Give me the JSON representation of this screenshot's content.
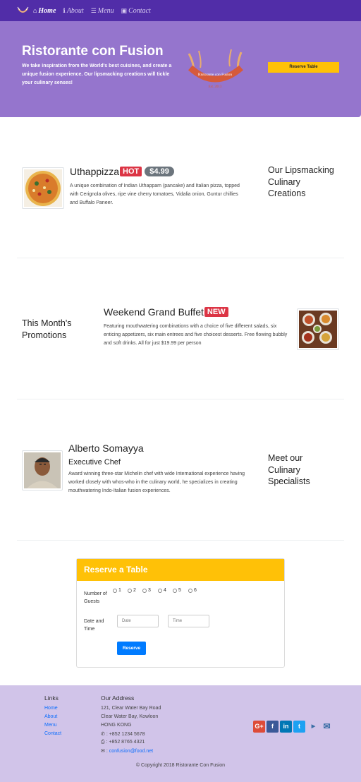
{
  "navbar": {
    "items": [
      {
        "label": "Home",
        "icon": "home-icon"
      },
      {
        "label": "About",
        "icon": "info-icon"
      },
      {
        "label": "Menu",
        "icon": "list-icon"
      },
      {
        "label": "Contact",
        "icon": "address-card-icon"
      }
    ]
  },
  "jumbotron": {
    "title": "Ristorante con Fusion",
    "text": "We take inspiration from the World's best cuisines, and create a unique fusion experience. Our lipsmacking creations will tickle your culinary senses!",
    "logo_text": "Ristorante con Fusion",
    "logo_est": "Est. 2013",
    "reserve_button": "Reserve Table"
  },
  "dish": {
    "name": "Uthappizza",
    "label": "HOT",
    "price": "$4.99",
    "description": "A unique combination of Indian Uthappam (pancake) and Italian pizza, topped with Cerignola olives, ripe vine cherry tomatoes, Vidalia onion, Guntur chillies and Buffalo Paneer.",
    "side_title": "Our Lipsmacking Culinary Creations"
  },
  "promotion": {
    "side_title": "This Month's Promotions",
    "name": "Weekend Grand Buffet",
    "label": "NEW",
    "description": "Featuring mouthwatering combinations with a choice of five different salads, six enticing appetizers, six main entrees and five choicest desserts. Free flowing bubbly and soft drinks. All for just $19.99 per person"
  },
  "leader": {
    "name": "Alberto Somayya",
    "designation": "Executive Chef",
    "description": "Award winning three-star Michelin chef with wide International experience having worked closely with whos-who in the culinary world, he specializes in creating mouthwatering Indo-Italian fusion experiences.",
    "side_title": "Meet our Culinary Specialists"
  },
  "reserve": {
    "header": "Reserve a Table",
    "guests_label": "Number of Guests",
    "guest_options": [
      "1",
      "2",
      "3",
      "4",
      "5",
      "6"
    ],
    "datetime_label": "Date and Time",
    "date_placeholder": "Date",
    "time_placeholder": "Time",
    "submit": "Reserve"
  },
  "footer": {
    "links_title": "Links",
    "links": [
      "Home",
      "About",
      "Menu",
      "Contact"
    ],
    "address_title": "Our Address",
    "address": [
      "121, Clear Water Bay Road",
      "Clear Water Bay, Kowloon",
      "HONG KONG"
    ],
    "phone": ": +852 1234 5678",
    "fax": ": +852 8765 4321",
    "email": "confusion@food.net",
    "social": [
      "google-plus-icon",
      "facebook-icon",
      "linkedin-icon",
      "twitter-icon",
      "youtube-icon",
      "mail-icon"
    ],
    "copyright": "© Copyright 2018 Ristorante Con Fusion"
  },
  "colors": {
    "navbar": "#512DA8",
    "jumbotron": "#9575CD",
    "footer": "#D1C4E9",
    "accent": "#FFC107",
    "badge": "#dc3545",
    "primary": "#007bff"
  }
}
